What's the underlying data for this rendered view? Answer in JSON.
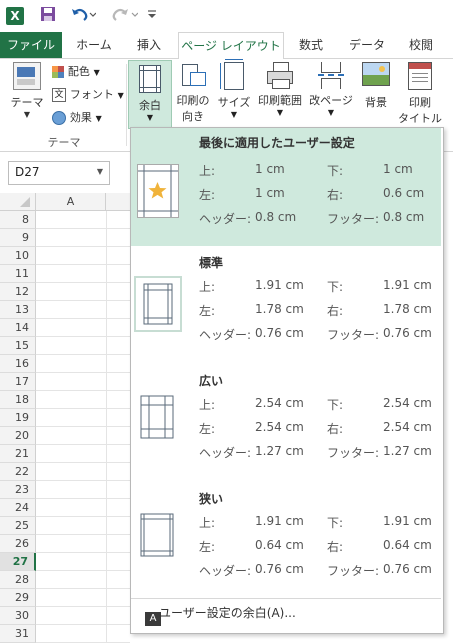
{
  "qat": {
    "icons": [
      "excel-logo-icon",
      "save-icon",
      "undo-icon",
      "redo-icon",
      "customize-icon"
    ],
    "logo": "X"
  },
  "tabs": [
    "ファイル",
    "ホーム",
    "挿入",
    "ページ レイアウト",
    "数式",
    "データ",
    "校閲"
  ],
  "ribbon": {
    "theme": {
      "label": "テーマ",
      "colors": "配色",
      "fonts": "フォント",
      "effects": "効果",
      "group": "テーマ"
    },
    "margins": {
      "label": "余白"
    },
    "orientation": {
      "label1": "印刷の",
      "label2": "向き"
    },
    "size": {
      "label": "サイズ"
    },
    "print_area": {
      "label": "印刷範囲"
    },
    "breaks": {
      "label": "改ページ"
    },
    "background": {
      "label": "背景"
    },
    "print_titles": {
      "label1": "印刷",
      "label2": "タイトル"
    }
  },
  "namebox": {
    "value": "D27"
  },
  "grid": {
    "column": "A",
    "rows": [
      "8",
      "9",
      "10",
      "11",
      "12",
      "13",
      "14",
      "15",
      "16",
      "17",
      "18",
      "19",
      "20",
      "21",
      "22",
      "23",
      "24",
      "25",
      "26",
      "27",
      "28",
      "29",
      "30",
      "31"
    ],
    "selected_row": "27"
  },
  "menu": {
    "options": [
      {
        "title": "最後に適用したユーザー設定",
        "top_l": "上:",
        "top_v": "1 cm",
        "bottom_l": "下:",
        "bottom_v": "1 cm",
        "left_l": "左:",
        "left_v": "1 cm",
        "right_l": "右:",
        "right_v": "0.6 cm",
        "header_l": "ヘッダー:",
        "header_v": "0.8 cm",
        "footer_l": "フッター:",
        "footer_v": "0.8 cm"
      },
      {
        "title": "標準",
        "top_l": "上:",
        "top_v": "1.91 cm",
        "bottom_l": "下:",
        "bottom_v": "1.91 cm",
        "left_l": "左:",
        "left_v": "1.78 cm",
        "right_l": "右:",
        "right_v": "1.78 cm",
        "header_l": "ヘッダー:",
        "header_v": "0.76 cm",
        "footer_l": "フッター:",
        "footer_v": "0.76 cm"
      },
      {
        "title": "広い",
        "top_l": "上:",
        "top_v": "2.54 cm",
        "bottom_l": "下:",
        "bottom_v": "2.54 cm",
        "left_l": "左:",
        "left_v": "2.54 cm",
        "right_l": "右:",
        "right_v": "2.54 cm",
        "header_l": "ヘッダー:",
        "header_v": "1.27 cm",
        "footer_l": "フッター:",
        "footer_v": "1.27 cm"
      },
      {
        "title": "狭い",
        "top_l": "上:",
        "top_v": "1.91 cm",
        "bottom_l": "下:",
        "bottom_v": "1.91 cm",
        "left_l": "左:",
        "left_v": "0.64 cm",
        "right_l": "右:",
        "right_v": "0.64 cm",
        "header_l": "ヘッダー:",
        "header_v": "0.76 cm",
        "footer_l": "フッター:",
        "footer_v": "0.76 cm"
      }
    ],
    "custom": "ユーザー設定の余白(A)...",
    "access_key": "A"
  },
  "colors": {
    "accent": "#217346",
    "highlight": "#cfe9dd"
  }
}
